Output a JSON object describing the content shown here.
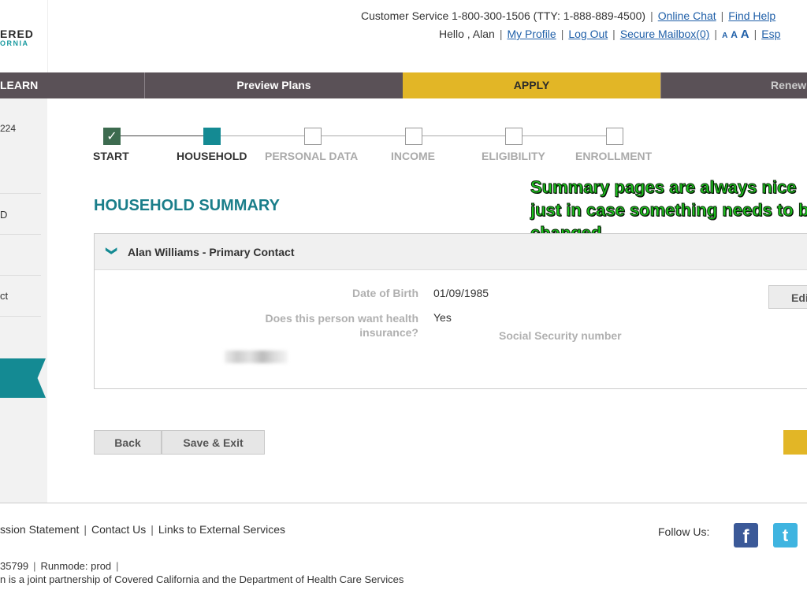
{
  "logo": {
    "line1": "ERED",
    "line2": "ORNIA"
  },
  "header": {
    "customer_service": "Customer Service 1-800-300-1506 (TTY: 1-888-889-4500)",
    "online_chat": "Online Chat",
    "find_help": "Find Help",
    "greeting": "Hello , Alan",
    "my_profile": "My Profile",
    "log_out": "Log Out",
    "secure_mailbox": "Secure Mailbox(0)",
    "font_small": "A",
    "font_medium": "A",
    "font_large": "A",
    "language": "Esp"
  },
  "nav": {
    "learn": "LEARN",
    "preview": "Preview Plans",
    "apply": "APPLY",
    "renew": "Renew"
  },
  "sidebar": {
    "item1": "224",
    "item2": "D",
    "item3": "ct"
  },
  "stepper": {
    "check": "✓",
    "steps": [
      "START",
      "HOUSEHOLD",
      "PERSONAL DATA",
      "INCOME",
      "ELIGIBILITY",
      "ENROLLMENT"
    ]
  },
  "page_title": "HOUSEHOLD SUMMARY",
  "annotation": "Summary pages are always nice just in case something needs to be changed.",
  "member": {
    "chevron": "❯",
    "name": "Alan Williams - Primary Contact",
    "dob_label": "Date of Birth",
    "dob_value": "01/09/1985",
    "insurance_label": "Does this person want health insurance?",
    "insurance_value": "Yes",
    "ssn_label": "Social Security number",
    "edit": "Edi"
  },
  "buttons": {
    "back": "Back",
    "save_exit": "Save & Exit"
  },
  "footer": {
    "mission": "ssion Statement",
    "contact": "Contact Us",
    "external": "Links to External Services",
    "follow": "Follow Us:",
    "fb_glyph": "f",
    "tw_glyph": "t",
    "build": "35799",
    "runmode": "Runmode: prod",
    "partnership": "n is a joint partnership of Covered California and the Department of Health Care Services"
  },
  "colors": {
    "teal": "#148a93",
    "nav": "#5a5157",
    "apply": "#e2b626",
    "annotation": "#1ec81e"
  }
}
